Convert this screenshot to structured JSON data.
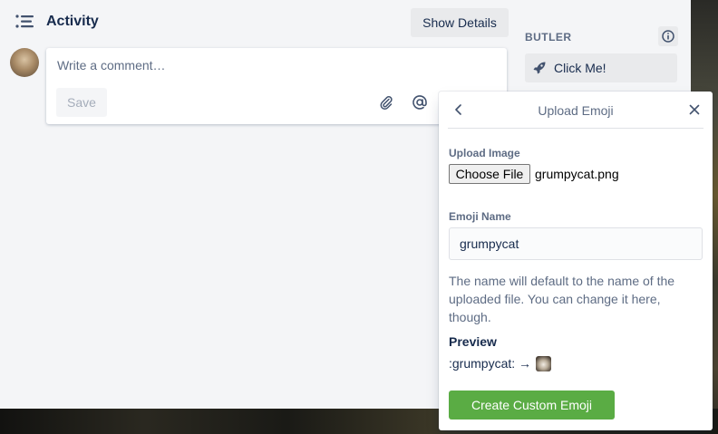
{
  "activity": {
    "title": "Activity",
    "show_details_label": "Show Details"
  },
  "comment": {
    "placeholder": "Write a comment…",
    "save_label": "Save"
  },
  "butler": {
    "label": "BUTLER",
    "button_label": "Click Me!"
  },
  "popover": {
    "title": "Upload Emoji",
    "upload_label": "Upload Image",
    "choose_file_label": "Choose File",
    "file_name": "grumpycat.png",
    "emoji_name_label": "Emoji Name",
    "emoji_name_value": "grumpycat",
    "help_text": "The name will default to the name of the uploaded file. You can change it here, though.",
    "preview_label": "Preview",
    "preview_text": ":grumpycat: →",
    "create_label": "Create Custom Emoji"
  },
  "icons": {
    "activity": "list-icon",
    "attach": "paperclip-icon",
    "mention": "at-sign-icon",
    "info": "info-icon",
    "rocket": "rocket-icon",
    "back": "chevron-left-icon",
    "close": "close-icon"
  },
  "colors": {
    "primary_button": "#5aac44",
    "text": "#172b4d",
    "muted_text": "#5e6c84",
    "card_background": "#f4f5f7"
  }
}
